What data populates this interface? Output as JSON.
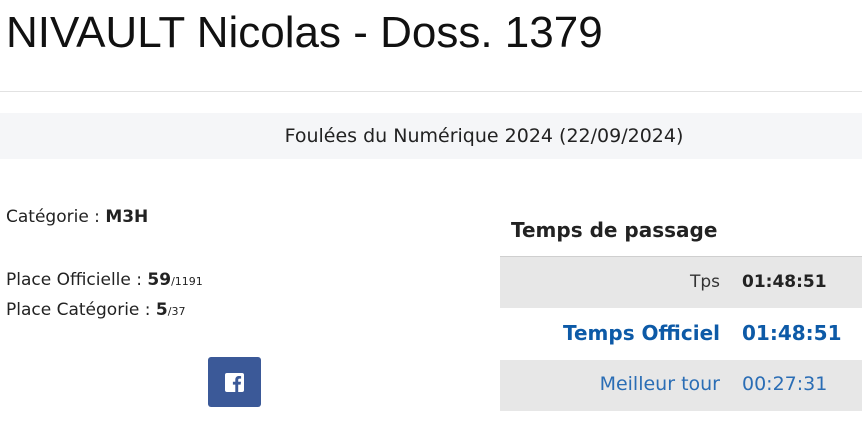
{
  "header": {
    "title": "NIVAULT Nicolas - Doss. 1379"
  },
  "event": {
    "title": "Foulées du Numérique 2024 (22/09/2024)"
  },
  "runner": {
    "category_label": "Catégorie : ",
    "category_value": "M3H",
    "official_place_label": "Place Officielle : ",
    "official_place_value": "59",
    "official_place_total": "/1191",
    "category_place_label": "Place Catégorie : ",
    "category_place_value": "5",
    "category_place_total": "/37"
  },
  "share": {
    "icon": "facebook-icon",
    "color": "#3b5998"
  },
  "splits": {
    "heading": "Temps de passage",
    "rows": [
      {
        "label": "Tps",
        "value": "01:48:51"
      },
      {
        "label": "Temps Officiel",
        "value": "01:48:51"
      },
      {
        "label": "Meilleur tour",
        "value": "00:27:31"
      }
    ]
  },
  "colors": {
    "accent": "#0d5aa7",
    "row_grey": "#e7e7e7",
    "event_bar": "#f5f6f8"
  }
}
